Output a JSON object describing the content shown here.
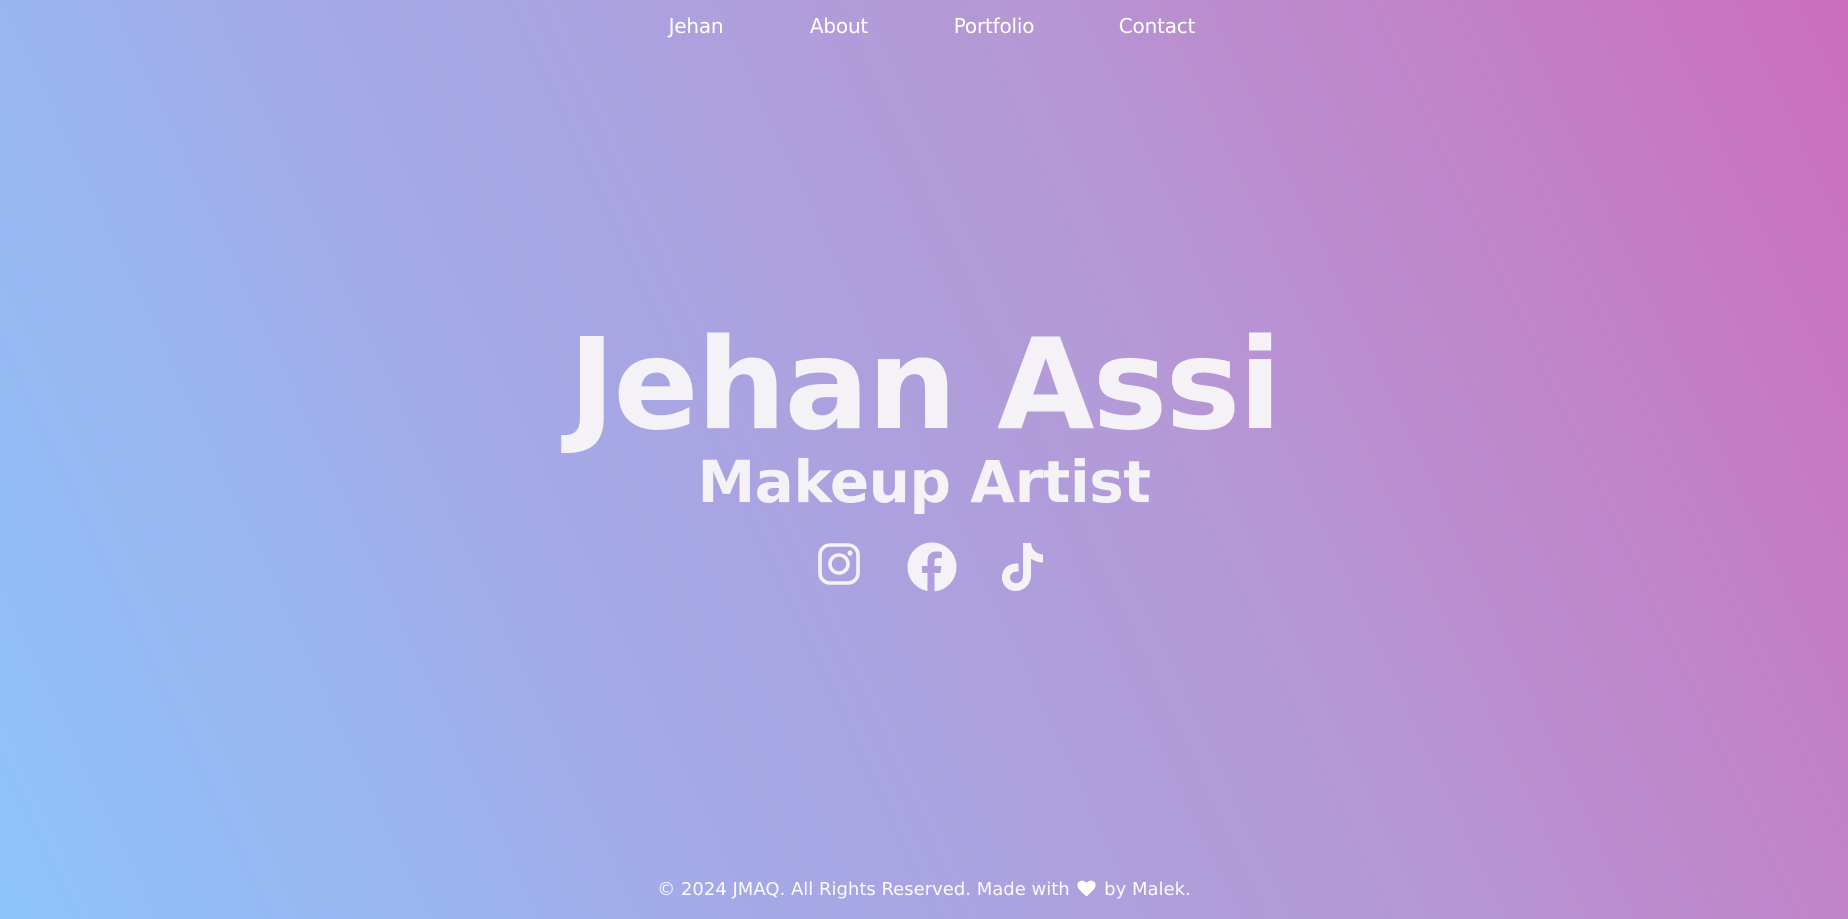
{
  "nav": {
    "items": [
      {
        "label": "Jehan"
      },
      {
        "label": "About"
      },
      {
        "label": "Portfolio"
      },
      {
        "label": "Contact"
      }
    ]
  },
  "hero": {
    "name": "Jehan Assi",
    "role": "Makeup Artist"
  },
  "social": {
    "icons": [
      "instagram-icon",
      "facebook-icon",
      "tiktok-icon"
    ]
  },
  "footer": {
    "text_before": "© 2024 JMAQ. All Rights Reserved. Made with",
    "text_after": "by Malek.",
    "heart_icon": "heart-icon"
  },
  "colors": {
    "gradient_start": "#8dc4fa",
    "gradient_end": "#cc6ebd",
    "text": "#f4f2f6"
  }
}
